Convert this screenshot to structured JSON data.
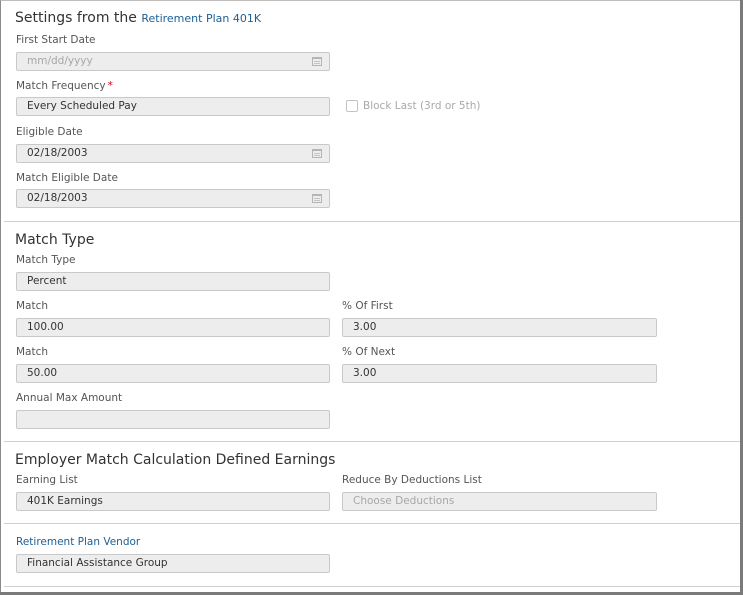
{
  "header": {
    "prefix": "Settings from the",
    "plan_name": "Retirement Plan 401K"
  },
  "dates": {
    "first_start_date": {
      "label": "First Start Date",
      "placeholder": "mm/dd/yyyy",
      "value": ""
    },
    "match_frequency": {
      "label": "Match Frequency",
      "required_mark": "*",
      "value": "Every Scheduled Pay"
    },
    "block_last": {
      "label": "Block Last (3rd or 5th)",
      "checked": false
    },
    "eligible_date": {
      "label": "Eligible Date",
      "value": "02/18/2003"
    },
    "match_eligible_date": {
      "label": "Match Eligible Date",
      "value": "02/18/2003"
    }
  },
  "match_type_section": {
    "title": "Match Type",
    "match_type": {
      "label": "Match Type",
      "value": "Percent"
    },
    "match1": {
      "label": "Match",
      "value": "100.00"
    },
    "pct_of_first": {
      "label": "% Of First",
      "value": "3.00"
    },
    "match2": {
      "label": "Match",
      "value": "50.00"
    },
    "pct_of_next": {
      "label": "% Of Next",
      "value": "3.00"
    },
    "annual_max": {
      "label": "Annual Max Amount",
      "value": ""
    }
  },
  "earnings_section": {
    "title": "Employer Match Calculation Defined Earnings",
    "earning_list": {
      "label": "Earning List",
      "value": "401K Earnings"
    },
    "reduce_by": {
      "label": "Reduce By Deductions List",
      "placeholder": "Choose Deductions"
    }
  },
  "vendor_section": {
    "label": "Retirement Plan Vendor",
    "value": "Financial Assistance Group"
  }
}
